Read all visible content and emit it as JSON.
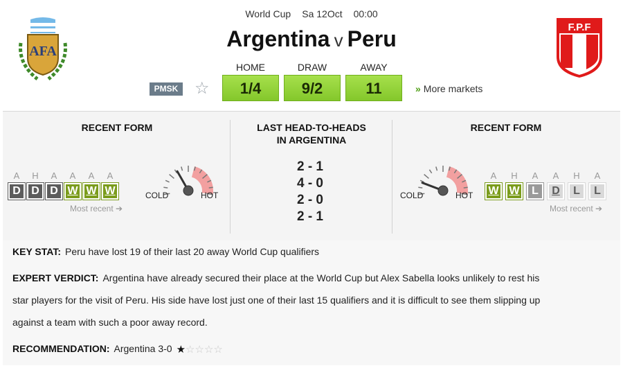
{
  "match": {
    "competition": "World Cup",
    "date": "Sa 12Oct",
    "time": "00:00",
    "home": "Argentina",
    "vs": "v",
    "away": "Peru"
  },
  "crests": {
    "home_text": "AFA",
    "away_text": "F.P.F"
  },
  "odds": {
    "home_label": "HOME",
    "draw_label": "DRAW",
    "away_label": "AWAY",
    "home": "1/4",
    "draw": "9/2",
    "away": "11"
  },
  "pmsk": "PMSK",
  "more_markets": "More markets",
  "form_home": {
    "title": "RECENT FORM",
    "venues": [
      "A",
      "H",
      "A",
      "A",
      "A",
      "A"
    ],
    "results": [
      "D",
      "D",
      "D",
      "W",
      "W",
      "W"
    ],
    "recent_label": "Most recent",
    "gauge_level": 0.35,
    "cold": "COLD",
    "hot": "HOT"
  },
  "head_to_head": {
    "title_line1": "LAST HEAD-TO-HEADS",
    "title_line2": "IN ARGENTINA",
    "scores": [
      "2 - 1",
      "4 - 0",
      "2 - 0",
      "2 - 1"
    ]
  },
  "form_away": {
    "title": "RECENT FORM",
    "venues": [
      "A",
      "H",
      "A",
      "A",
      "H",
      "A"
    ],
    "results": [
      "W",
      "W",
      "L",
      "D",
      "L",
      "L"
    ],
    "recent_label": "Most recent",
    "gauge_level": 0.15,
    "cold": "COLD",
    "hot": "HOT"
  },
  "key_stat": {
    "label": "KEY STAT:",
    "text": "Peru have lost 19 of their last 20 away World Cup qualifiers"
  },
  "expert": {
    "label": "EXPERT VERDICT:",
    "line1": "Argentina have already secured their place at the World Cup but Alex Sabella looks unlikely to rest his",
    "line2": "star players for the visit of Peru. His side have lost just one of their last 15 qualifiers and it is difficult to see them slipping up",
    "line3": "against a team with such a poor away record."
  },
  "recommendation": {
    "label": "RECOMMENDATION:",
    "text": "Argentina 3-0",
    "stars_filled": 1,
    "stars_total": 5
  },
  "colors": {
    "odds_green": "#8fd336",
    "win": "#7b9c1c",
    "draw": "#5c5c5c",
    "loss": "#9a9a9a",
    "peru_red": "#e01a1a",
    "argentina_blue": "#74b9e8"
  },
  "icons": {
    "favourite": "star-outline-icon",
    "more": "double-chevron-right-icon",
    "recent_arrow": "arrow-right-icon"
  }
}
